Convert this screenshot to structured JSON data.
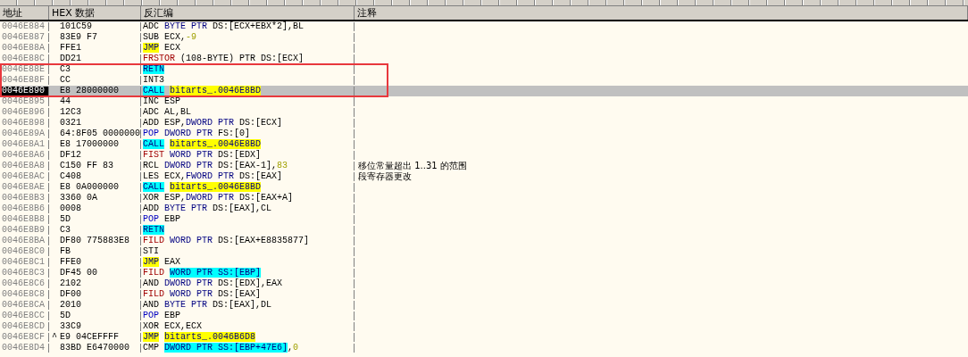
{
  "columns": [
    "地址",
    "HEX 数据",
    "反汇编",
    "注释"
  ],
  "rows": [
    {
      "address": "0046E884",
      "hex": "101C59",
      "selected": false,
      "asm": [
        {
          "text": "ADC ",
          "kind": "plain"
        },
        {
          "text": "BYTE PTR",
          "kind": "size"
        },
        {
          "text": " DS:[ECX+EBX*2],BL",
          "kind": "plain"
        }
      ]
    },
    {
      "address": "0046E887",
      "hex": "83E9 F7",
      "selected": false,
      "asm": [
        {
          "text": "SUB ECX,",
          "kind": "plain"
        },
        {
          "text": "-9",
          "kind": "const"
        }
      ]
    },
    {
      "address": "0046E88A",
      "hex": "FFE1",
      "selected": false,
      "asm": [
        {
          "text": "JMP",
          "kind": "yellow"
        },
        {
          "text": " ECX",
          "kind": "plain"
        }
      ]
    },
    {
      "address": "0046E88C",
      "hex": "DD21",
      "selected": false,
      "asm": [
        {
          "text": "FRSTOR",
          "kind": "fpu"
        },
        {
          "text": " (108-BYTE) PTR DS:[ECX]",
          "kind": "plain"
        }
      ]
    },
    {
      "address": "0046E88E",
      "hex": "C3",
      "selected": false,
      "asm": [
        {
          "text": "RETN",
          "kind": "cyan"
        }
      ]
    },
    {
      "address": "0046E88F",
      "hex": "CC",
      "selected": false,
      "asm": [
        {
          "text": "INT3",
          "kind": "plain"
        }
      ]
    },
    {
      "address": "0046E890",
      "hex": "E8 28000000",
      "selected": true,
      "asm": [
        {
          "text": "CALL",
          "kind": "cyan"
        },
        {
          "text": "bitarts_.0046E8BD",
          "kind": "yellow",
          "space_before": true
        }
      ]
    },
    {
      "address": "0046E895",
      "hex": "44",
      "selected": false,
      "asm": [
        {
          "text": "INC ESP",
          "kind": "plain"
        }
      ]
    },
    {
      "address": "0046E896",
      "hex": "12C3",
      "selected": false,
      "asm": [
        {
          "text": "ADC AL,BL",
          "kind": "plain"
        }
      ]
    },
    {
      "address": "0046E898",
      "hex": "0321",
      "selected": false,
      "asm": [
        {
          "text": "ADD ESP,",
          "kind": "plain"
        },
        {
          "text": "DWORD PTR",
          "kind": "size"
        },
        {
          "text": " DS:[ECX]",
          "kind": "plain"
        }
      ]
    },
    {
      "address": "0046E89A",
      "hex": "64:8F05 0000000",
      "selected": false,
      "asm": [
        {
          "text": "POP",
          "kind": "stack"
        },
        {
          "text": "DWORD PTR",
          "kind": "size",
          "space_before": true
        },
        {
          "text": " FS:[0]",
          "kind": "plain"
        }
      ]
    },
    {
      "address": "0046E8A1",
      "hex": "E8 17000000",
      "selected": false,
      "asm": [
        {
          "text": "CALL",
          "kind": "cyan"
        },
        {
          "text": "bitarts_.0046E8BD",
          "kind": "yellow",
          "space_before": true
        }
      ]
    },
    {
      "address": "0046E8A6",
      "hex": "DF12",
      "selected": false,
      "asm": [
        {
          "text": "FIST",
          "kind": "fpu"
        },
        {
          "text": "WORD PTR",
          "kind": "size",
          "space_before": true
        },
        {
          "text": " DS:[EDX]",
          "kind": "plain"
        }
      ]
    },
    {
      "address": "0046E8A8",
      "hex": "C150 FF 83",
      "selected": false,
      "comment": "移位常量超出 1..31 的范围",
      "asm": [
        {
          "text": "RCL ",
          "kind": "plain"
        },
        {
          "text": "DWORD PTR",
          "kind": "size"
        },
        {
          "text": " DS:[EAX-1],",
          "kind": "plain"
        },
        {
          "text": "83",
          "kind": "const"
        }
      ]
    },
    {
      "address": "0046E8AC",
      "hex": "C408",
      "selected": false,
      "comment": "段寄存器更改",
      "asm": [
        {
          "text": "LES ECX,",
          "kind": "plain"
        },
        {
          "text": "FWORD PTR",
          "kind": "size"
        },
        {
          "text": " DS:[EAX]",
          "kind": "plain"
        }
      ]
    },
    {
      "address": "0046E8AE",
      "hex": "E8 0A000000",
      "selected": false,
      "asm": [
        {
          "text": "CALL",
          "kind": "cyan"
        },
        {
          "text": "bitarts_.0046E8BD",
          "kind": "yellow",
          "space_before": true
        }
      ]
    },
    {
      "address": "0046E8B3",
      "hex": "3360 0A",
      "selected": false,
      "asm": [
        {
          "text": "XOR ESP,",
          "kind": "plain"
        },
        {
          "text": "DWORD PTR",
          "kind": "size"
        },
        {
          "text": " DS:[EAX+A]",
          "kind": "plain"
        }
      ]
    },
    {
      "address": "0046E8B6",
      "hex": "0008",
      "selected": false,
      "asm": [
        {
          "text": "ADD ",
          "kind": "plain"
        },
        {
          "text": "BYTE PTR",
          "kind": "size"
        },
        {
          "text": " DS:[EAX],CL",
          "kind": "plain"
        }
      ]
    },
    {
      "address": "0046E8B8",
      "hex": "5D",
      "selected": false,
      "asm": [
        {
          "text": "POP",
          "kind": "stack"
        },
        {
          "text": " EBP",
          "kind": "plain"
        }
      ]
    },
    {
      "address": "0046E8B9",
      "hex": "C3",
      "selected": false,
      "asm": [
        {
          "text": "RETN",
          "kind": "cyan"
        }
      ]
    },
    {
      "address": "0046E8BA",
      "hex": "DF80 775883E8",
      "selected": false,
      "asm": [
        {
          "text": "FILD",
          "kind": "fpu"
        },
        {
          "text": "WORD PTR",
          "kind": "size",
          "space_before": true
        },
        {
          "text": " DS:[EAX+E8835877]",
          "kind": "plain"
        }
      ]
    },
    {
      "address": "0046E8C0",
      "hex": "FB",
      "selected": false,
      "asm": [
        {
          "text": "STI",
          "kind": "plain"
        }
      ]
    },
    {
      "address": "0046E8C1",
      "hex": "FFE0",
      "selected": false,
      "asm": [
        {
          "text": "JMP",
          "kind": "yellow"
        },
        {
          "text": " EAX",
          "kind": "plain"
        }
      ]
    },
    {
      "address": "0046E8C3",
      "hex": "DF45 00",
      "selected": false,
      "asm": [
        {
          "text": "FILD",
          "kind": "fpu"
        },
        {
          "text": "WORD PTR SS:[EBP]",
          "kind": "cyan",
          "space_before": true
        }
      ]
    },
    {
      "address": "0046E8C6",
      "hex": "2102",
      "selected": false,
      "asm": [
        {
          "text": "AND ",
          "kind": "plain"
        },
        {
          "text": "DWORD PTR",
          "kind": "size"
        },
        {
          "text": " DS:[EDX],EAX",
          "kind": "plain"
        }
      ]
    },
    {
      "address": "0046E8C8",
      "hex": "DF00",
      "selected": false,
      "asm": [
        {
          "text": "FILD",
          "kind": "fpu"
        },
        {
          "text": "WORD PTR",
          "kind": "size",
          "space_before": true
        },
        {
          "text": " DS:[EAX]",
          "kind": "plain"
        }
      ]
    },
    {
      "address": "0046E8CA",
      "hex": "2010",
      "selected": false,
      "asm": [
        {
          "text": "AND ",
          "kind": "plain"
        },
        {
          "text": "BYTE PTR",
          "kind": "size"
        },
        {
          "text": " DS:[EAX],DL",
          "kind": "plain"
        }
      ]
    },
    {
      "address": "0046E8CC",
      "hex": "5D",
      "selected": false,
      "asm": [
        {
          "text": "POP",
          "kind": "stack"
        },
        {
          "text": " EBP",
          "kind": "plain"
        }
      ]
    },
    {
      "address": "0046E8CD",
      "hex": "33C9",
      "selected": false,
      "asm": [
        {
          "text": "XOR ECX,ECX",
          "kind": "plain"
        }
      ]
    },
    {
      "address": "0046E8CF",
      "jump_mark": "^",
      "hex": "E9 04CEFFFF",
      "selected": false,
      "asm": [
        {
          "text": "JMP",
          "kind": "yellow"
        },
        {
          "text": "bitarts_.0046B6D8",
          "kind": "yellow",
          "space_before": true
        }
      ]
    },
    {
      "address": "0046E8D4",
      "hex": "83BD E6470000",
      "selected": false,
      "asm": [
        {
          "text": "CMP",
          "kind": "plain"
        },
        {
          "text": "DWORD PTR SS:[EBP+47E6]",
          "kind": "cyan",
          "space_before": true
        },
        {
          "text": ",",
          "kind": "plain"
        },
        {
          "text": "0",
          "kind": "const"
        }
      ]
    }
  ]
}
